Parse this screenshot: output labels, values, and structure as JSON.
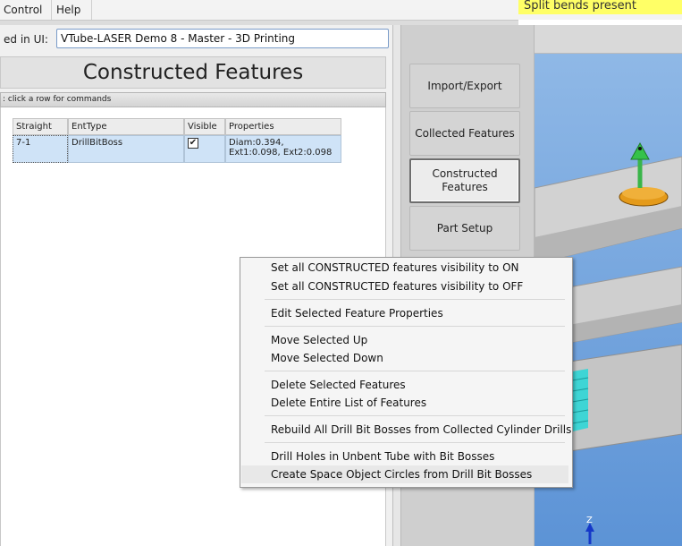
{
  "menubar": {
    "control": "Control",
    "help": "Help"
  },
  "warning_text": "Split bends present",
  "name_row": {
    "label": "ed in UI:",
    "value": "VTube-LASER Demo 8 - Master - 3D Printing"
  },
  "panel_title": "Constructed Features",
  "hint": ": click a row for commands",
  "table": {
    "headers": [
      "Straight",
      "EntType",
      "Visible",
      "Properties"
    ],
    "rows": [
      {
        "straight": "7-1",
        "enttype": "DrillBitBoss",
        "visible": "✔",
        "properties": "Diam:0.394, Ext1:0.098, Ext2:0.098"
      }
    ]
  },
  "commands": {
    "import_export": "Import/Export",
    "collected": "Collected Features",
    "constructed": "Constructed Features",
    "part_setup": "Part Setup"
  },
  "context_menu": {
    "items": [
      "Set all CONSTRUCTED features visibility to ON",
      "Set all CONSTRUCTED features visibility to OFF",
      "Edit Selected Feature Properties",
      "Move Selected Up",
      "Move Selected Down",
      "Delete Selected Features",
      "Delete Entire List of Features",
      "Rebuild All Drill Bit Bosses from Collected Cylinder Drills",
      "Drill Holes in Unbent Tube with Bit Bosses",
      "Create Space Object Circles from Drill Bit Bosses"
    ]
  },
  "viewport": {
    "axis_label": "Z"
  },
  "colors": {
    "warning_bg": "#ffff66",
    "row_selected": "#cfe3f7",
    "viewport_sky": "#6f9fdc",
    "tube": "#c9c9c9",
    "cyan_feature": "#2fd6d6"
  }
}
